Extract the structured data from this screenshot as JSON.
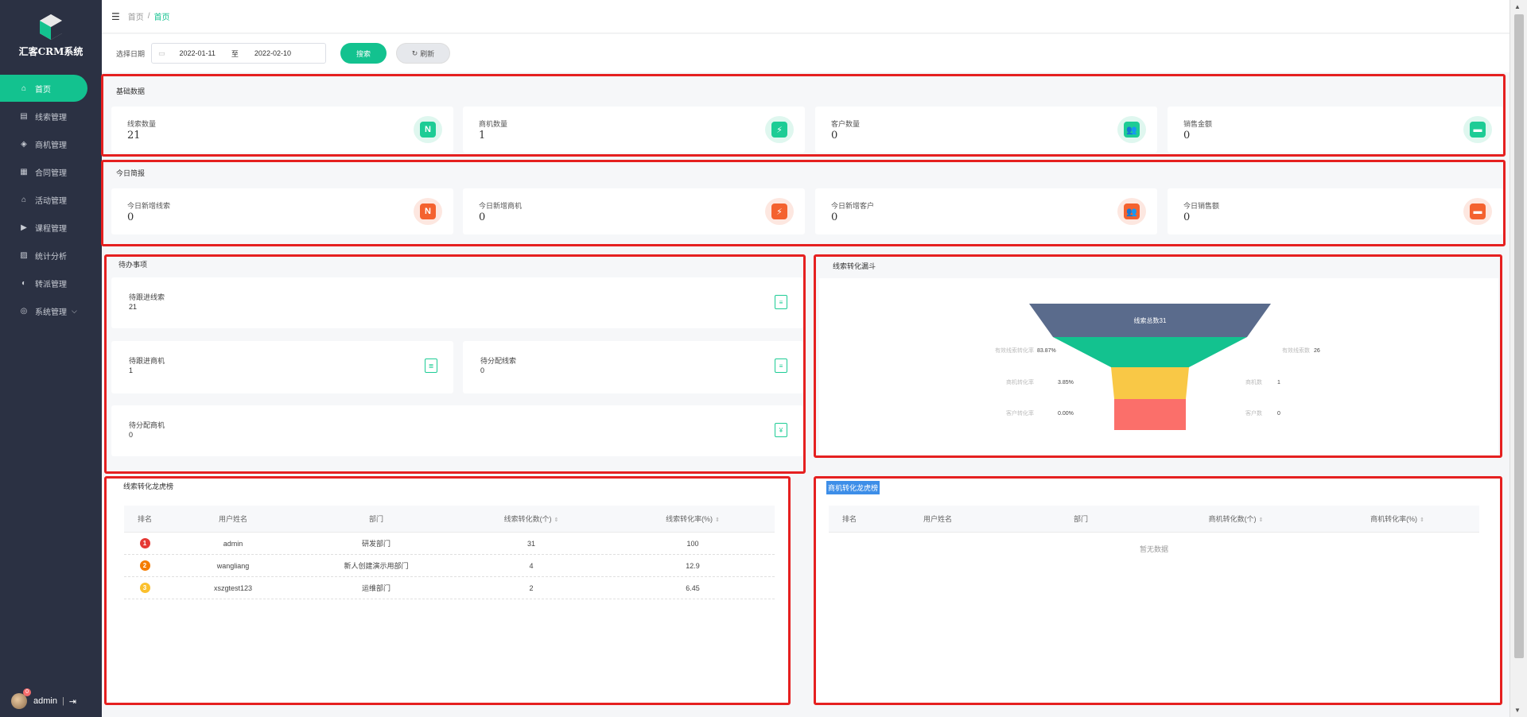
{
  "app": {
    "logo_text": "汇客CRM系统"
  },
  "sidebar": {
    "items": [
      {
        "label": "首页",
        "icon": "home-icon",
        "glyph": "⌂"
      },
      {
        "label": "线索管理",
        "icon": "clue-icon",
        "glyph": "▤"
      },
      {
        "label": "商机管理",
        "icon": "opportunity-icon",
        "glyph": "◈"
      },
      {
        "label": "合同管理",
        "icon": "contract-icon",
        "glyph": "▦"
      },
      {
        "label": "活动管理",
        "icon": "activity-icon",
        "glyph": "⌂"
      },
      {
        "label": "课程管理",
        "icon": "course-icon",
        "glyph": "▶"
      },
      {
        "label": "统计分析",
        "icon": "chart-icon",
        "glyph": "▨"
      },
      {
        "label": "转派管理",
        "icon": "transfer-icon",
        "glyph": "◐"
      },
      {
        "label": "系统管理",
        "icon": "settings-icon",
        "glyph": "◎"
      }
    ],
    "user": "admin",
    "badge": "0",
    "separator": "|",
    "logout_glyph": "⇥"
  },
  "topbar": {
    "crumb_home": "首页",
    "crumb_sep": "/",
    "crumb_current": "首页"
  },
  "filter": {
    "label": "选择日期",
    "start": "2022-01-11",
    "to": "至",
    "end": "2022-02-10",
    "search": "搜索",
    "refresh": "刷新"
  },
  "basic": {
    "title": "基础数据",
    "cards": [
      {
        "label": "线索数量",
        "value": "21",
        "glyph": "N"
      },
      {
        "label": "商机数量",
        "value": "1",
        "glyph": "⚡"
      },
      {
        "label": "客户数量",
        "value": "0",
        "glyph": "👥"
      },
      {
        "label": "销售金额",
        "value": "0",
        "glyph": "▬"
      }
    ]
  },
  "today": {
    "title": "今日简报",
    "cards": [
      {
        "label": "今日新增线索",
        "value": "0",
        "glyph": "N"
      },
      {
        "label": "今日新增商机",
        "value": "0",
        "glyph": "⚡"
      },
      {
        "label": "今日新增客户",
        "value": "0",
        "glyph": "👥"
      },
      {
        "label": "今日销售额",
        "value": "0",
        "glyph": "▬"
      }
    ]
  },
  "todo": {
    "title": "待办事项",
    "items": [
      {
        "label": "待跟进线索",
        "value": "21"
      },
      {
        "label": "待跟进商机",
        "value": "1"
      },
      {
        "label": "待分配线索",
        "value": "0"
      },
      {
        "label": "待分配商机",
        "value": "0"
      }
    ]
  },
  "funnel": {
    "title": "线索转化漏斗",
    "layers": [
      {
        "label": "线索总数31",
        "color": "#5a6b8c"
      },
      {
        "label": "",
        "color": "#13c28f"
      },
      {
        "label": "",
        "color": "#f9c846"
      },
      {
        "label": "",
        "color": "#fb6f6a"
      }
    ],
    "left": [
      {
        "name": "有效线索转化率",
        "value": "83.87%"
      },
      {
        "name": "商机转化率",
        "value": "3.85%"
      },
      {
        "name": "客户转化率",
        "value": "0.00%"
      }
    ],
    "right": [
      {
        "name": "有效线索数",
        "value": "26"
      },
      {
        "name": "商机数",
        "value": "1"
      },
      {
        "name": "客户数",
        "value": "0"
      }
    ]
  },
  "clue_rank": {
    "title": "线索转化龙虎榜",
    "headers": [
      "排名",
      "用户姓名",
      "部门",
      "线索转化数(个)",
      "线索转化率(%)"
    ],
    "rows": [
      {
        "rank": "1",
        "name": "admin",
        "dept": "研发部门",
        "count": "31",
        "rate": "100"
      },
      {
        "rank": "2",
        "name": "wangliang",
        "dept": "新人创建演示用部门",
        "count": "4",
        "rate": "12.9"
      },
      {
        "rank": "3",
        "name": "xszgtest123",
        "dept": "运维部门",
        "count": "2",
        "rate": "6.45"
      }
    ]
  },
  "opp_rank": {
    "title": "商机转化龙虎榜",
    "headers": [
      "排名",
      "用户姓名",
      "部门",
      "商机转化数(个)",
      "商机转化率(%)"
    ],
    "empty": "暂无数据"
  }
}
